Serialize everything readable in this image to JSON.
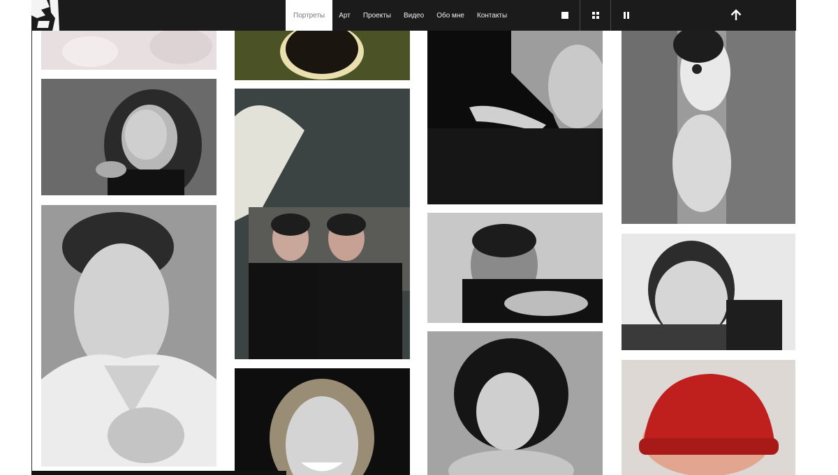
{
  "header": {
    "nav": [
      {
        "label": "Портреты",
        "active": true
      },
      {
        "label": "Арт",
        "active": false
      },
      {
        "label": "Проекты",
        "active": false
      },
      {
        "label": "Видео",
        "active": false
      },
      {
        "label": "Обо мне",
        "active": false
      },
      {
        "label": "Контакты",
        "active": false
      }
    ],
    "tools": [
      "single-view-icon",
      "grid-view-icon",
      "pause-icon"
    ],
    "scroll_top_icon": "arrow-up-icon"
  },
  "gallery": {
    "photos": [
      {
        "subject": "portrait-top-cropped"
      },
      {
        "subject": "woman-hand-on-face"
      },
      {
        "subject": "smiling-man-white-shirt"
      },
      {
        "subject": "overhead-head-green"
      },
      {
        "subject": "two-young-men-turtlenecks"
      },
      {
        "subject": "laughing-blond-person"
      },
      {
        "subject": "man-hand-over-eye"
      },
      {
        "subject": "man-resting-on-arm"
      },
      {
        "subject": "woman-short-dark-hair"
      },
      {
        "subject": "mime-behind-fence"
      },
      {
        "subject": "boy-smiling"
      },
      {
        "subject": "man-red-beanie"
      }
    ]
  },
  "colors": {
    "header_bg": "#1b1b1b",
    "accent_red": "#c0201d"
  }
}
